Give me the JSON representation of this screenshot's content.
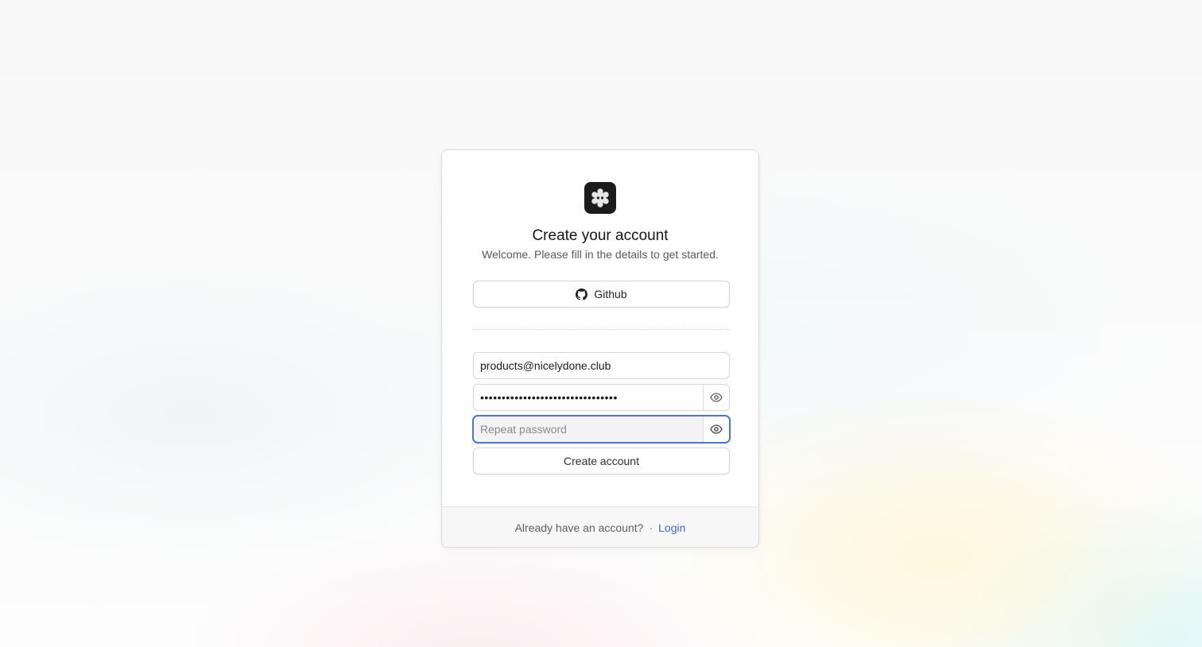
{
  "header": {
    "logo_icon": "gear-icon",
    "title": "Create your account",
    "subtitle": "Welcome. Please fill in the details to get started."
  },
  "social": {
    "github_label": "Github",
    "github_icon": "github-icon"
  },
  "form": {
    "email_value": "products@nicelydone.club",
    "password_value": "••••••••••••••••••••••••••••••••",
    "password_toggle_icon": "eye-icon",
    "repeat_password_placeholder": "Repeat password",
    "repeat_password_value": "",
    "submit_label": "Create account"
  },
  "footer": {
    "prompt": "Already have an account?",
    "separator": "·",
    "login_label": "Login"
  },
  "colors": {
    "accent_link": "#3d6ad6",
    "focus_ring": "#4a72e0",
    "logo_bg": "#1c1c1c"
  }
}
